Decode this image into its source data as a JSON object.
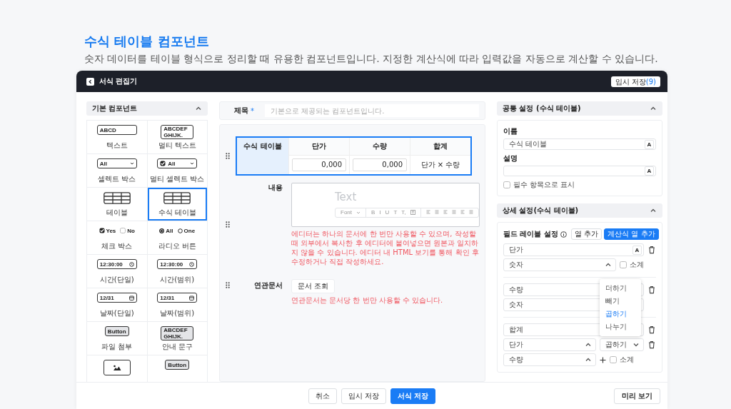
{
  "intro": {
    "title": "수식 테이블 컴포넌트",
    "description": "숫자 데이터를 테이블 형식으로 정리할 때 유용한 컴포넌트입니다. 지정한 계산식에 따라 입력값을 자동으로 계산할 수 있습니다."
  },
  "window": {
    "title": "서식 편집기",
    "temp_save": {
      "label": "임시 저장",
      "count": "(9)"
    }
  },
  "palette": {
    "title": "기본 컴포넌트",
    "expanded": true,
    "items": [
      {
        "kind": "text",
        "label": "텍스트",
        "preview": "ABCD",
        "selected": false
      },
      {
        "kind": "multitext",
        "label": "멀티 텍스트",
        "preview": "ABCDEF GHIJK.",
        "selected": false
      },
      {
        "kind": "select",
        "label": "셀렉트 박스",
        "preview": "All",
        "selected": false
      },
      {
        "kind": "multiselect",
        "label": "멀티 셀렉트 박스",
        "preview": "All",
        "checked": true,
        "selected": false
      },
      {
        "kind": "table",
        "label": "테이블",
        "selected": false
      },
      {
        "kind": "table",
        "label": "수식 테이블",
        "selected": true
      },
      {
        "kind": "checkbox",
        "label": "체크 박스",
        "options": [
          {
            "label": "Yes",
            "checked": true
          },
          {
            "label": "No",
            "checked": false
          }
        ],
        "selected": false
      },
      {
        "kind": "radio",
        "label": "라디오 버튼",
        "options": [
          {
            "label": "All",
            "selected": true
          },
          {
            "label": "One",
            "selected": false
          }
        ],
        "selected": false
      },
      {
        "kind": "time",
        "label": "시간(단일)",
        "preview": "12:30:00",
        "selected": false
      },
      {
        "kind": "time",
        "label": "시간(범위)",
        "preview": "12:30:00",
        "selected": false
      },
      {
        "kind": "date",
        "label": "날짜(단일)",
        "preview": "12/31",
        "selected": false
      },
      {
        "kind": "date",
        "label": "날짜(범위)",
        "preview": "12/31",
        "selected": false
      },
      {
        "kind": "button",
        "label": "파일 첨부",
        "preview": "Button",
        "selected": false
      },
      {
        "kind": "notice",
        "label": "안내 문구",
        "preview": "ABCDEF GHIJK.",
        "selected": false
      },
      {
        "kind": "image",
        "selected": false
      },
      {
        "kind": "button",
        "preview": "Button",
        "selected": false
      }
    ]
  },
  "form": {
    "title_field": {
      "label": "제목",
      "required_mark": "*",
      "placeholder": "기본으로 제공되는 컴포넌트입니다."
    },
    "formula_table": {
      "label": "수식 테이블",
      "selected": true,
      "columns": [
        "단가",
        "수량",
        "합계"
      ],
      "cells": [
        {
          "kind": "input",
          "value": "0,000"
        },
        {
          "kind": "input",
          "value": "0,000"
        },
        {
          "kind": "text",
          "value": "단가 × 수량"
        }
      ]
    },
    "content": {
      "label": "내용",
      "placeholder": "Text",
      "toolbar": {
        "font": "Font",
        "format_buttons": [
          "B",
          "I",
          "U",
          "T",
          "T,"
        ]
      },
      "note": "에디터는 하나의 문서에 한 번만 사용할 수 있으며, 작성할 때 외부에서 복사한 후 에디터에 붙여넣으면 원본과 일치하지 않을 수 있습니다. 에디터 내 HTML 보기를 통해 확인 후 수정하거나 직접 작성하세요."
    },
    "related": {
      "label": "연관문서",
      "button": "문서 조회",
      "note": "연관문서는 문서당 한 번만 사용할 수 있습니다."
    }
  },
  "settings": {
    "common": {
      "title": "공통 설정 (수식 테이블)",
      "expanded": true,
      "name_label": "이름",
      "name_value": "수식 테이블",
      "name_format_key": "A",
      "desc_label": "설명",
      "desc_format_key": "A",
      "required": {
        "label": "필수 항목으로 표시",
        "checked": false
      }
    },
    "detail": {
      "title": "상세 설정(수식 테이블)",
      "expanded": true,
      "fields_title": "필드 레이블 설정",
      "add_column": "열 추가",
      "add_formula_column": "계산식 열 추가",
      "fields": [
        {
          "kind": "column",
          "name": "단가",
          "format_key": "A",
          "type": "숫자",
          "subtotal": {
            "label": "소계",
            "checked": false
          }
        },
        {
          "kind": "column",
          "name": "수량",
          "type": "숫자"
        },
        {
          "kind": "formula",
          "name": "합계",
          "operand1": "단가",
          "operator": "곱하기",
          "operand2": "수량",
          "subtotal": {
            "label": "소계",
            "checked": false
          },
          "operator_menu": [
            {
              "label": "더하기",
              "selected": false
            },
            {
              "label": "빼기",
              "selected": false
            },
            {
              "label": "곱하기",
              "selected": true
            },
            {
              "label": "나누기",
              "selected": false
            }
          ]
        }
      ]
    }
  },
  "footer": {
    "buttons": [
      {
        "label": "취소",
        "kind": "default"
      },
      {
        "label": "임시 저장",
        "kind": "default"
      },
      {
        "label": "서식 저장",
        "kind": "primary"
      }
    ],
    "preview_button": "미리 보기"
  }
}
